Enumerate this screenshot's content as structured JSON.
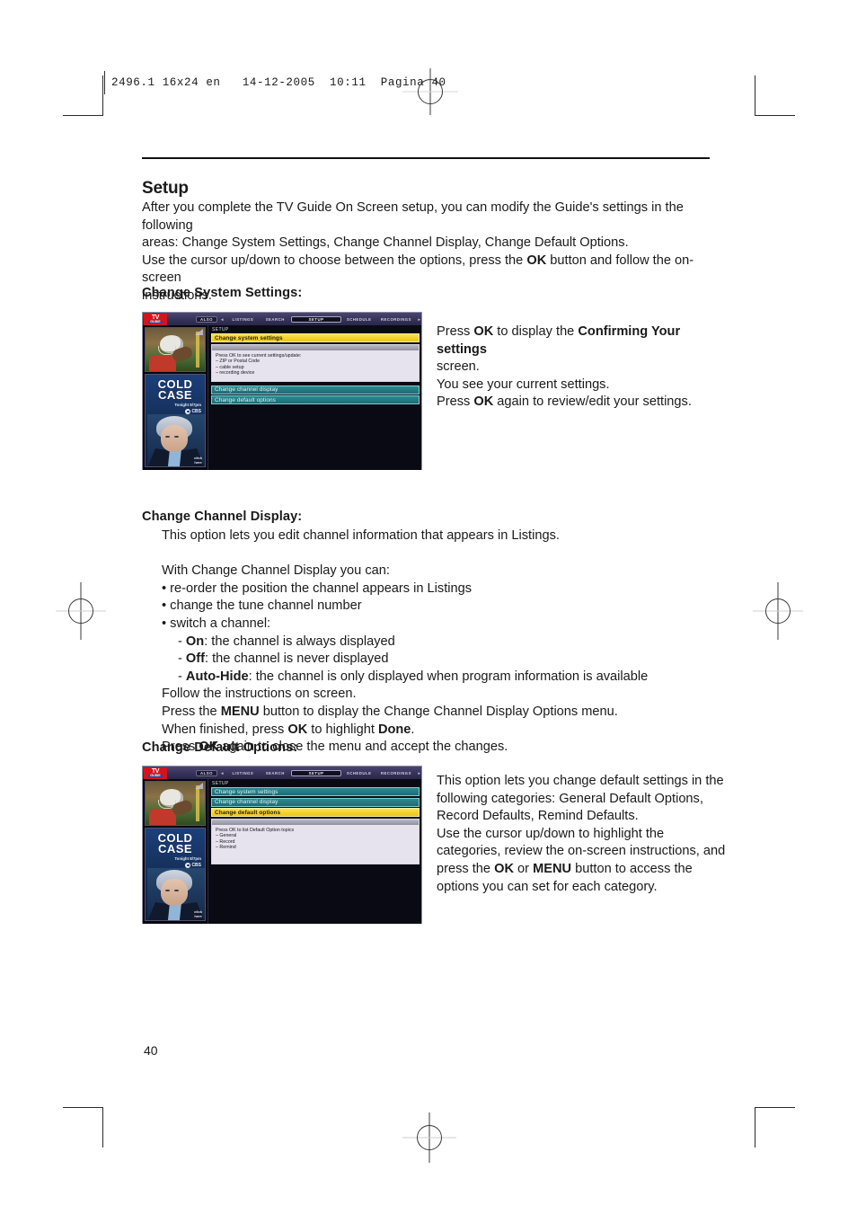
{
  "imprint": {
    "text": "2496.1 16x24 en   14-12-2005  10:11  Pagina 40"
  },
  "page": {
    "number": "40"
  },
  "setup": {
    "title": "Setup",
    "intro_line1": "After you complete the TV Guide On Screen setup, you can modify the Guide's settings in the following",
    "intro_line2": "areas: Change System Settings, Change Channel Display, Change Default Options.",
    "intro_line3_a": "Use the cursor up/down to choose between the options, press the ",
    "intro_line3_ok": "OK",
    "intro_line3_b": " button and follow the on-screen",
    "intro_line4": "instructions."
  },
  "change_system_settings": {
    "heading": "Change System Settings:",
    "note_line1_a": "Press ",
    "note_line1_ok": "OK",
    "note_line1_b": " to display the ",
    "note_line1_bold": "Confirming Your settings",
    "note_line2": "screen.",
    "note_line3": " You see your current settings.",
    "note_line4_a": "Press ",
    "note_line4_ok": "OK",
    "note_line4_b": " again to review/edit your settings."
  },
  "change_channel_display": {
    "heading": "Change Channel Display:",
    "line1": "This option lets you edit channel information that appears in Listings.",
    "line2": "With Change Channel Display you can:",
    "bullets": [
      "• re-order the position the channel appears in Listings",
      "• change the tune channel number",
      "• switch a channel:"
    ],
    "sub_on_label": "On",
    "sub_on_text": ": the channel is always displayed",
    "sub_off_label": "Off",
    "sub_off_text": ": the channel is never displayed",
    "sub_auto_label": "Auto-Hide",
    "sub_auto_text": ": the channel is only displayed when program information is available",
    "line3": "Follow the instructions on screen.",
    "line4_a": "Press the ",
    "line4_menu": "MENU",
    "line4_b": " button to display the Change Channel Display Options menu.",
    "line5_a": "When finished, press ",
    "line5_ok": "OK",
    "line5_b": " to highlight ",
    "line5_done": "Done",
    "line5_c": ".",
    "line6_a": "Press ",
    "line6_ok": "OK",
    "line6_b": " again to close the menu and accept the changes."
  },
  "change_default_options": {
    "heading": "Change Default Options:",
    "note_line1": "This option lets you change default settings in the",
    "note_line2": "following categories: General Default Options,",
    "note_line3": "Record Defaults, Remind Defaults.",
    "note_line4": "Use the cursor up/down to highlight the",
    "note_line5": "categories, review the on-screen instructions, and",
    "note_line6_a": "press the ",
    "note_line6_ok": "OK",
    "note_line6_mid": " or ",
    "note_line6_menu": "MENU",
    "note_line6_b": " button to access the",
    "note_line7": "options you can set for each category."
  },
  "tvguide_screen_1": {
    "logo_line1": "TV",
    "logo_line2": "GUIDE",
    "nav": {
      "also": "ALSO",
      "left_arrow": "◄",
      "items": [
        "LISTINGS",
        "SEARCH",
        "SETUP",
        "SCHEDULE",
        "RECORDINGS"
      ],
      "selected": "SETUP",
      "right_arrow": "►"
    },
    "panel_label": "SETUP",
    "rows": [
      {
        "label": "Change system settings",
        "state": "highlighted"
      },
      {
        "label": "Change channel display",
        "state": "normal"
      },
      {
        "label": "Change default options",
        "state": "normal"
      }
    ],
    "infobox": [
      "Press OK to see current settings/update:",
      "– ZIP or Postal Code",
      "– cable setup",
      "– recording device"
    ],
    "ad": {
      "title_line1": "COLD",
      "title_line2": "CASE",
      "tonight": "Tonight 8/7pm",
      "network": "CBS",
      "click_line1": "click",
      "click_line2": "here"
    }
  },
  "tvguide_screen_2": {
    "logo_line1": "TV",
    "logo_line2": "GUIDE",
    "nav": {
      "also": "ALSO",
      "left_arrow": "◄",
      "items": [
        "LISTINGS",
        "SEARCH",
        "SETUP",
        "SCHEDULE",
        "RECORDINGS"
      ],
      "selected": "SETUP",
      "right_arrow": "►"
    },
    "panel_label": "SETUP",
    "rows": [
      {
        "label": "Change system settings",
        "state": "normal"
      },
      {
        "label": "Change channel display",
        "state": "normal"
      },
      {
        "label": "Change default options",
        "state": "highlighted"
      }
    ],
    "infobox": [
      "Press OK to list Default Option topics",
      "– General",
      "– Record",
      "– Remind"
    ],
    "ad": {
      "title_line1": "COLD",
      "title_line2": "CASE",
      "tonight": "Tonight 8/7pm",
      "network": "CBS",
      "click_line1": "click",
      "click_line2": "here"
    }
  },
  "colors": {
    "highlight_yellow": "#ffe14f",
    "row_teal": "#2c8a91",
    "logo_red": "#d5131c",
    "nav_purple": "#37335a"
  }
}
